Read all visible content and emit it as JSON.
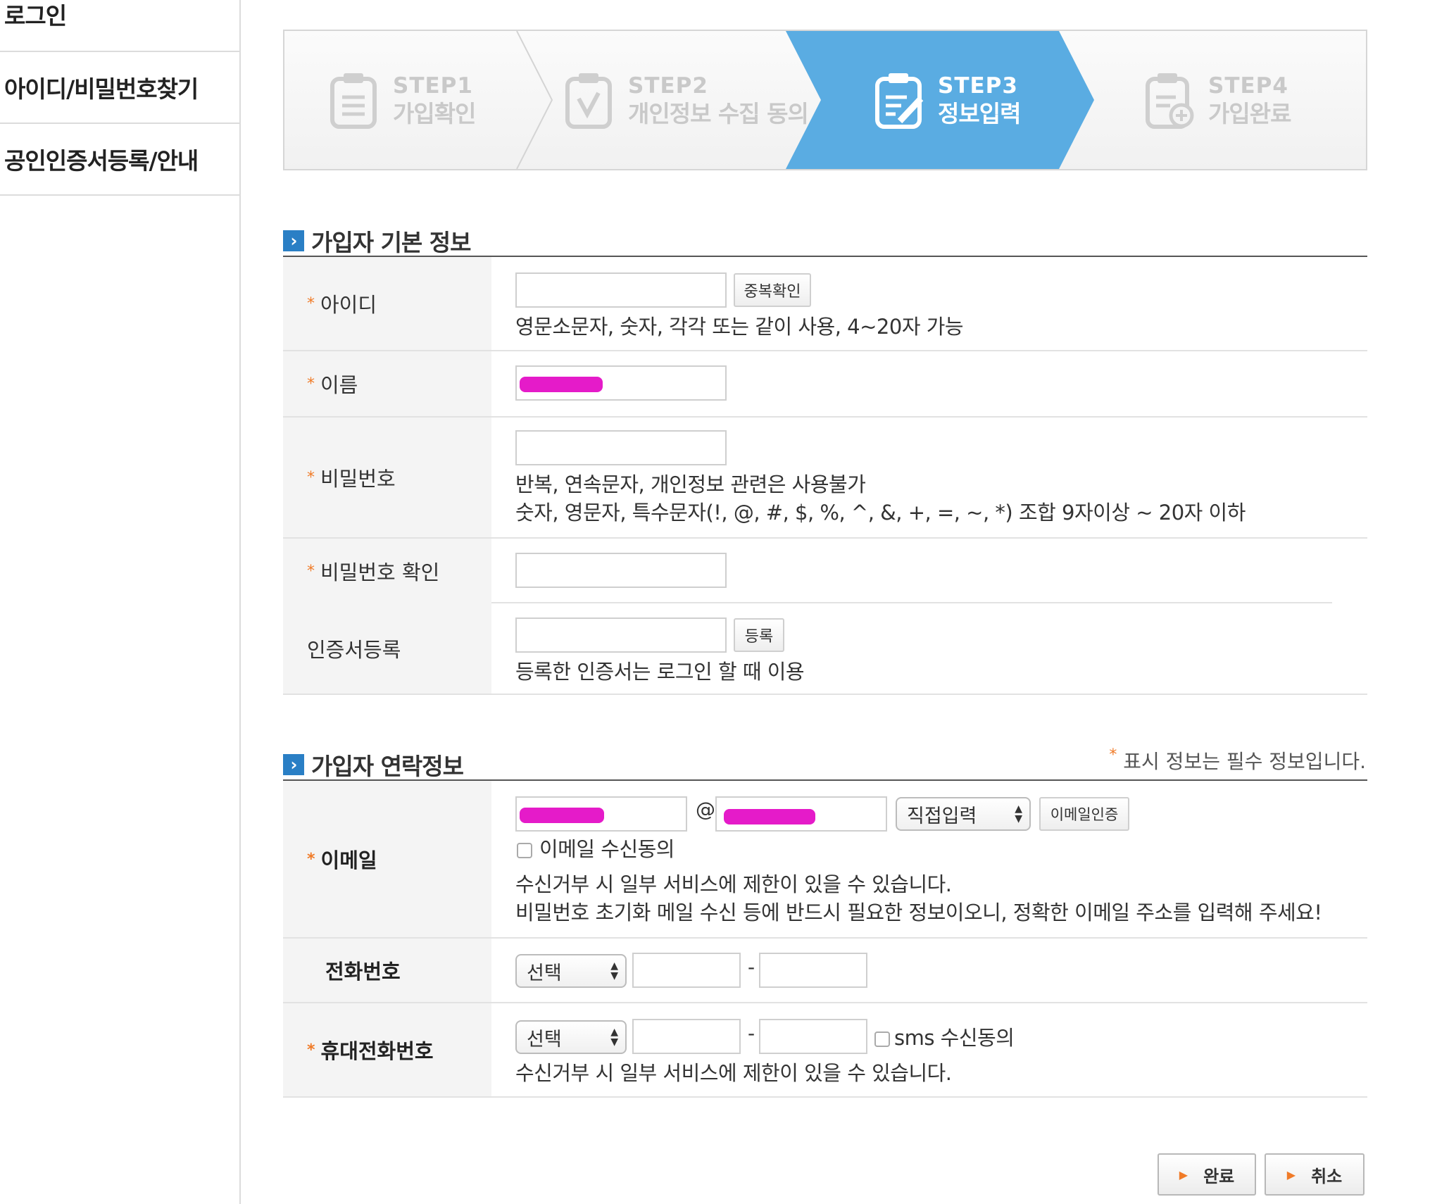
{
  "sidebar": {
    "items": [
      {
        "label": "로그인"
      },
      {
        "label": "아이디/비밀번호찾기"
      },
      {
        "label": "공인인증서등록/안내"
      }
    ]
  },
  "steps": [
    {
      "num": "STEP1",
      "label": "가입확인",
      "icon": "clipboard-list-icon",
      "active": false
    },
    {
      "num": "STEP2",
      "label": "개인정보 수집 동의",
      "icon": "clipboard-check-icon",
      "active": false
    },
    {
      "num": "STEP3",
      "label": "정보입력",
      "icon": "clipboard-edit-icon",
      "active": true
    },
    {
      "num": "STEP4",
      "label": "가입완료",
      "icon": "clipboard-plus-icon",
      "active": false
    }
  ],
  "colors": {
    "active_step": "#5aace2",
    "accent_orange": "#f07b28",
    "section_arrow": "#2a7fc5",
    "redaction": "#e51bc9"
  },
  "basic": {
    "title": "가입자 기본 정보",
    "id": {
      "label": "아이디",
      "check_button": "중복확인",
      "help": "영문소문자, 숫자, 각각 또는 같이 사용, 4~20자 가능"
    },
    "name": {
      "label": "이름"
    },
    "password": {
      "label": "비밀번호",
      "help1": "반복, 연속문자, 개인정보 관련은 사용불가",
      "help2": "숫자, 영문자, 특수문자(!, @, #, $, %, ^, &, +, =, ~, *) 조합 9자이상 ~ 20자 이하"
    },
    "password_confirm": {
      "label": "비밀번호 확인"
    },
    "cert": {
      "label": "인증서등록",
      "button": "등록",
      "help": "등록한 인증서는 로그인 할 때 이용"
    }
  },
  "contact": {
    "title": "가입자 연락정보",
    "required_note": "표시 정보는 필수 정보입니다.",
    "required_star": "*",
    "email": {
      "label": "이메일",
      "at": "@",
      "domain_select": "직접입력",
      "verify_button": "이메일인증",
      "consent_label": "이메일 수신동의",
      "help1": "수신거부 시 일부 서비스에 제한이 있을 수 있습니다.",
      "help2": "비밀번호 초기화 메일 수신 등에 반드시 필요한 정보이오니, 정확한 이메일 주소를 입력해 주세요!"
    },
    "phone": {
      "label": "전화번호",
      "select": "선택",
      "dash": "-"
    },
    "mobile": {
      "label": "휴대전화번호",
      "select": "선택",
      "dash": "-",
      "consent_label": "sms 수신동의",
      "help": "수신거부 시 일부 서비스에 제한이 있을 수 있습니다."
    }
  },
  "actions": {
    "submit": "완료",
    "cancel": "취소"
  }
}
